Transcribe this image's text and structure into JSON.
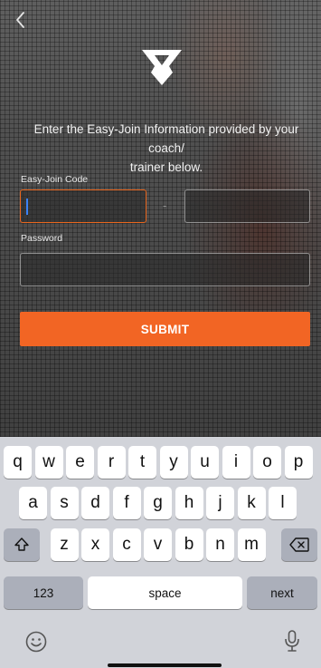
{
  "header": {
    "back_icon": "chevron-left-icon",
    "logo_icon": "brand-logo-icon"
  },
  "form": {
    "instructions_line1": "Enter the Easy-Join Information provided by your coach/",
    "instructions_line2": "trainer below.",
    "code_label": "Easy-Join Code",
    "code_separator": "-",
    "password_label": "Password",
    "code_part1_value": "",
    "code_part2_value": "",
    "password_value": "",
    "submit_label": "SUBMIT",
    "accent_color": "#f26524"
  },
  "keyboard": {
    "row1": [
      "q",
      "w",
      "e",
      "r",
      "t",
      "y",
      "u",
      "i",
      "o",
      "p"
    ],
    "row2": [
      "a",
      "s",
      "d",
      "f",
      "g",
      "h",
      "j",
      "k",
      "l"
    ],
    "row3": [
      "z",
      "x",
      "c",
      "v",
      "b",
      "n",
      "m"
    ],
    "shift_icon": "shift-icon",
    "delete_icon": "backspace-icon",
    "numbers_label": "123",
    "space_label": "space",
    "next_label": "next",
    "emoji_icon": "emoji-icon",
    "mic_icon": "microphone-icon"
  }
}
